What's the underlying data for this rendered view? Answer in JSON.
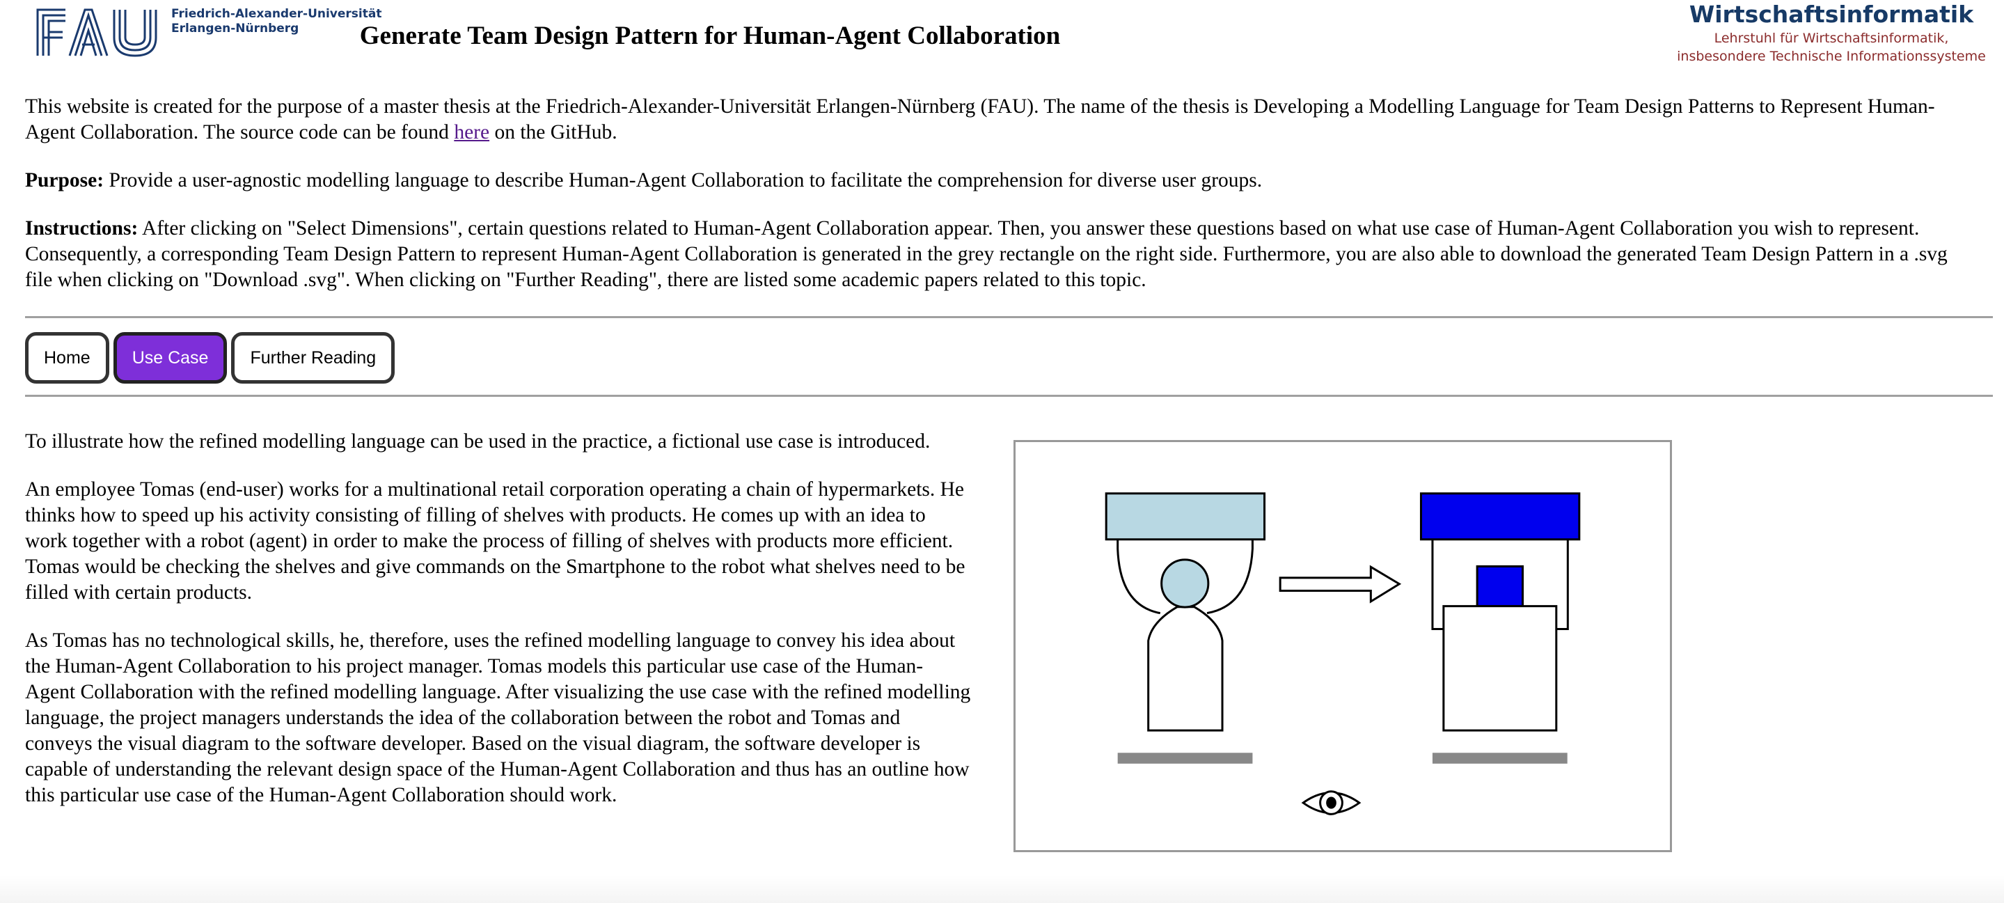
{
  "header": {
    "fau_logo_text": "FAU",
    "university_line1": "Friedrich-Alexander-Universität",
    "university_line2": "Erlangen-Nürnberg",
    "title": "Generate Team Design Pattern for Human-Agent Collaboration",
    "chair_title": "Wirtschaftsinformatik",
    "chair_line1": "Lehrstuhl für Wirtschaftsinformatik,",
    "chair_line2": "insbesondere Technische Informationssysteme"
  },
  "intro": {
    "p1_before": "This website is created for the purpose of a master thesis at the Friedrich-Alexander-Universität Erlangen-Nürnberg (FAU). The name of the thesis is Developing a Modelling Language for Team Design Patterns to Represent Human-Agent Collaboration. The source code can be found ",
    "p1_link": "here",
    "p1_after": " on the GitHub.",
    "purpose_label": "Purpose:",
    "purpose_text": " Provide a user-agnostic modelling language to describe Human-Agent Collaboration to facilitate the comprehension for diverse user groups.",
    "instructions_label": "Instructions:",
    "instructions_text": " After clicking on \"Select Dimensions\", certain questions related to Human-Agent Collaboration appear. Then, you answer these questions based on what use case of Human-Agent Collaboration you wish to represent. Consequently, a corresponding Team Design Pattern to represent Human-Agent Collaboration is generated in the grey rectangle on the right side. Furthermore, you are also able to download the generated Team Design Pattern in a .svg file when clicking on \"Download .svg\". When clicking on \"Further Reading\", there are listed some academic papers related to this topic."
  },
  "nav": {
    "home": "Home",
    "use_case": "Use Case",
    "further_reading": "Further Reading",
    "active": "use_case"
  },
  "use_case": {
    "paragraphs": [
      "To illustrate how the refined modelling language can be used in the practice, a fictional use case is introduced.",
      "An employee Tomas (end-user) works for a multinational retail corporation operating a chain of hypermarkets. He thinks how to speed up his activity consisting of filling of shelves with products. He comes up with an idea to work together with a robot (agent) in order to make the process of filling of shelves with products more efficient. Tomas would be checking the shelves and give commands on the Smartphone to the robot what shelves need to be filled with certain products.",
      "As Tomas has no technological skills, he, therefore, uses the refined modelling language to convey his idea about the Human-Agent Collaboration to his project manager. Tomas models this particular use case of the Human-Agent Collaboration with the refined modelling language. After visualizing the use case with the refined modelling language, the project managers understands the idea of the collaboration between the robot and Tomas and conveys the visual diagram to the software developer. Based on the visual diagram, the software developer is capable of understanding the relevant design space of the Human-Agent Collaboration and thus has an outline how this particular use case of the Human-Agent Collaboration should work."
    ]
  },
  "diagram": {
    "human_color": "#b8d8e3",
    "agent_color": "#0000ee",
    "bar_color": "#888888"
  }
}
